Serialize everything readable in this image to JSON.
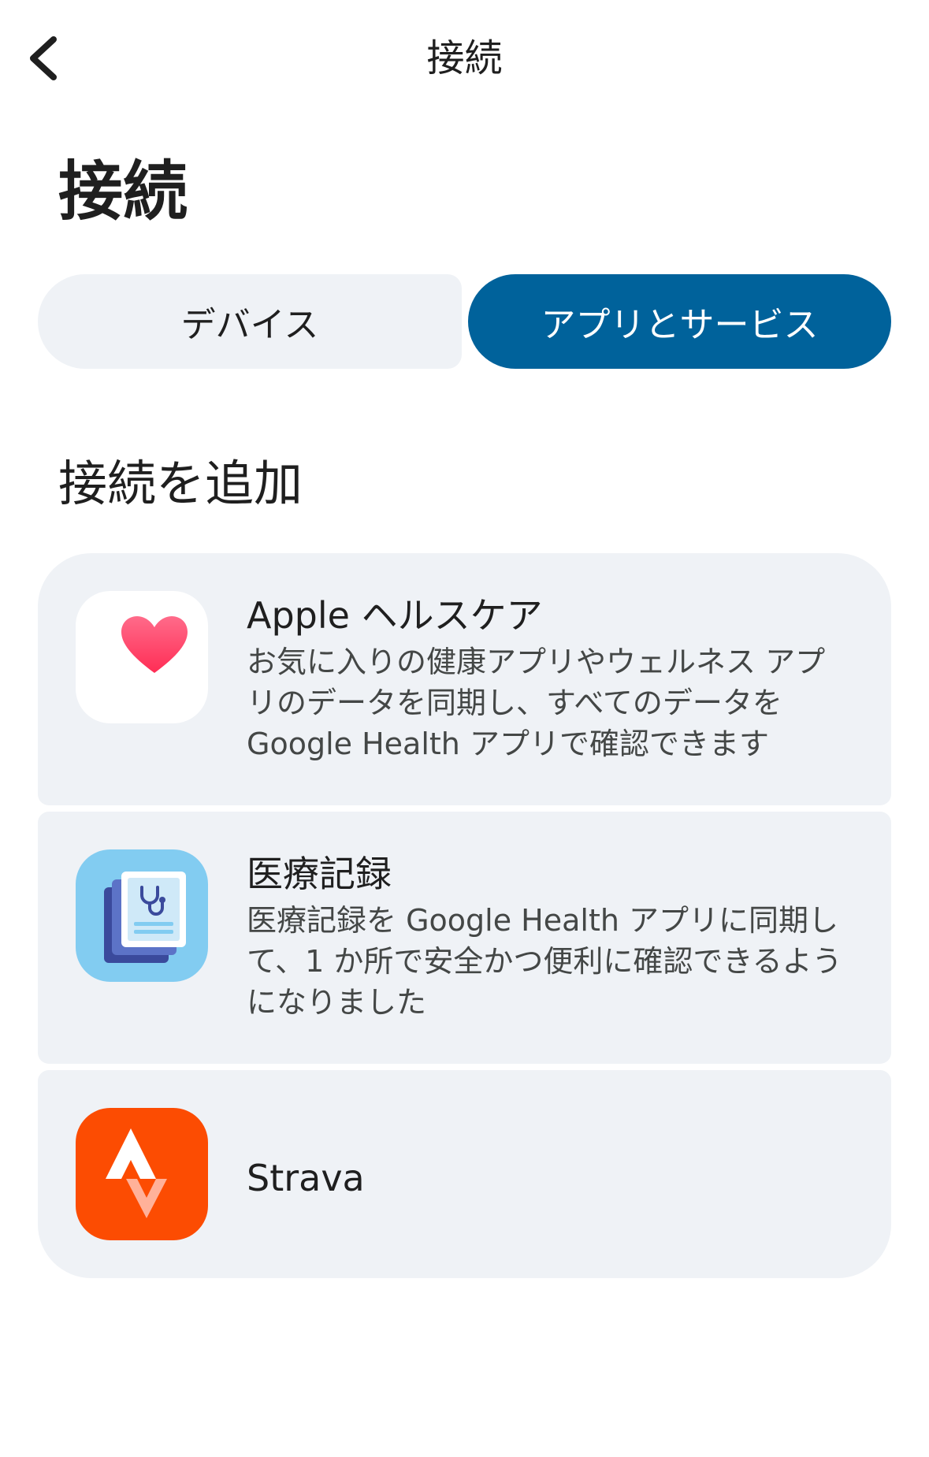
{
  "header": {
    "back_icon": "chevron-left-icon",
    "title": "接続"
  },
  "page": {
    "title": "接続"
  },
  "tabs": [
    {
      "label": "デバイス",
      "selected": false
    },
    {
      "label": "アプリとサービス",
      "selected": true
    }
  ],
  "section": {
    "title": "接続を追加"
  },
  "connections": [
    {
      "icon": "heart-icon",
      "title": "Apple ヘルスケア",
      "description": "お気に入りの健康アプリやウェルネス アプリのデータを同期し、すべてのデータを Google Health アプリで確認できます"
    },
    {
      "icon": "medical-records-icon",
      "title": "医療記録",
      "description": "医療記録を Google Health アプリに同期して、1 か所で安全かつ便利に確認できるようになりました"
    },
    {
      "icon": "strava-logo-icon",
      "title": "Strava",
      "description": ""
    }
  ],
  "colors": {
    "accent": "#00629b",
    "card_bg": "#eff2f6",
    "strava": "#fc4c02",
    "medical_icon_bg": "#82ccf1",
    "heart": "#ff3b5c"
  }
}
